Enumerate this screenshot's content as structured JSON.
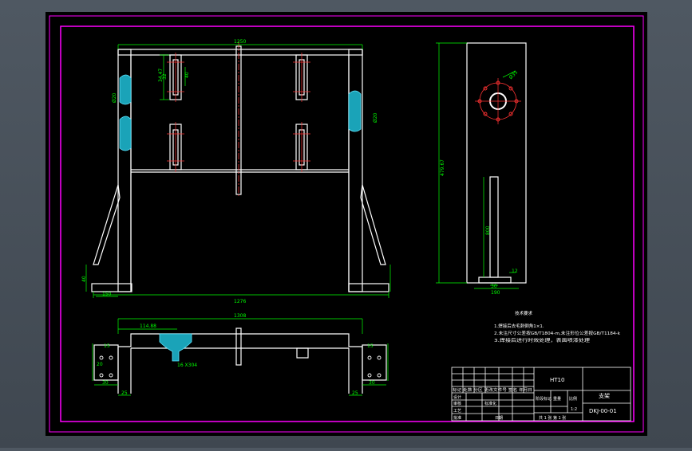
{
  "drawing": {
    "dimensions": {
      "top_width": "1250",
      "inner_width": "1276",
      "plan_width": "1308",
      "left_foot_height": "40",
      "left_foot_width": "150",
      "slot_a": "34.47",
      "slot_b": "32",
      "slot_c": "40",
      "gusset_left": "Ø20",
      "gusset_right": "Ø20",
      "side_height": "479.67",
      "post_height": "800",
      "post_width": "30",
      "base_width": "190",
      "base_h": "12",
      "circle_dia": "Ø35",
      "plan_slot": "114.88",
      "plan_bolt": "20",
      "plan_left_h": "15",
      "plan_left_w": "30",
      "plan_left_w2": "25",
      "plan_right_h": "15",
      "plan_right_w": "30",
      "plan_right_w2": "25",
      "weld_note": "16 X304"
    },
    "notes": {
      "title": "技术要求",
      "line1": "1.焊接后去毛刺倒角1×1.",
      "line2": "2.未注尺寸公差按GB/T1804-m,未注形位公差按GB/T1184-k",
      "line3": "3.焊接后进行时效处理，表面喷漆处理"
    },
    "title_block": {
      "material": "HT10",
      "part_name": "支架",
      "drawing_no": "DKJ-00-01",
      "scale": "1:2",
      "sheet_info": "共 1 张 第 1 张",
      "row_labels": [
        "设计",
        "审核",
        "工艺",
        "批准"
      ],
      "header_row": "标记 处数 分区 更改文件号 签名 年月日",
      "std_label": "标准化",
      "date_label": "日期",
      "stage_label": "阶段标记",
      "weight_label": "重量",
      "ratio_label": "比例"
    }
  },
  "colors": {
    "background": "#4a535c",
    "sheet": "#000000",
    "border": "#ff00ff",
    "part": "#ffffff",
    "dimension": "#00ff00",
    "centerline": "#ff3333",
    "hatch": "#00bcd4"
  }
}
